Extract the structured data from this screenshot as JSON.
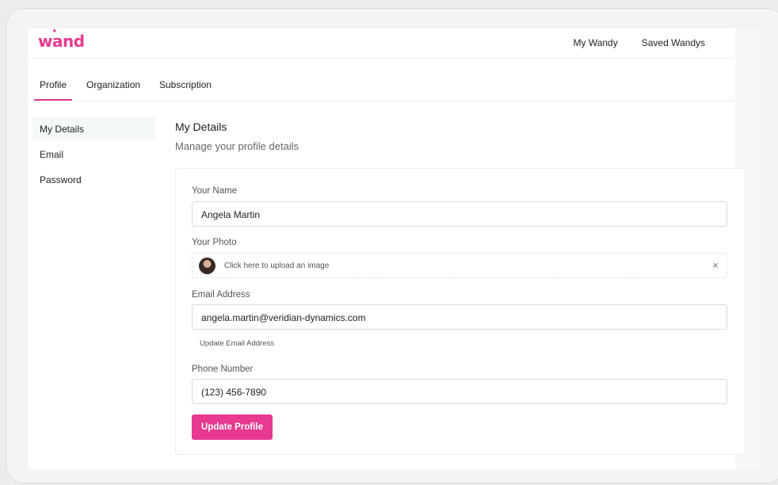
{
  "brand": {
    "logo_text": "wand",
    "accent_color": "#e6398f"
  },
  "topnav": {
    "items": [
      {
        "label": "My Wandy"
      },
      {
        "label": "Saved Wandys"
      }
    ]
  },
  "tabs": [
    {
      "label": "Profile",
      "active": true
    },
    {
      "label": "Organization"
    },
    {
      "label": "Subscription"
    }
  ],
  "sidebar": {
    "items": [
      {
        "label": "My Details",
        "active": true
      },
      {
        "label": "Email"
      },
      {
        "label": "Password"
      }
    ]
  },
  "main": {
    "title": "My Details",
    "subtitle": "Manage your profile details",
    "name": {
      "label": "Your Name",
      "value": "Angela Martin"
    },
    "photo": {
      "label": "Your Photo",
      "upload_text": "Click here to upload an image",
      "close_icon": "×"
    },
    "email": {
      "label": "Email Address",
      "value": "angela.martin@veridian-dynamics.com",
      "help_link": "Update Email Address"
    },
    "phone": {
      "label": "Phone Number",
      "value": "(123) 456-7890"
    },
    "submit_label": "Update Profile"
  }
}
